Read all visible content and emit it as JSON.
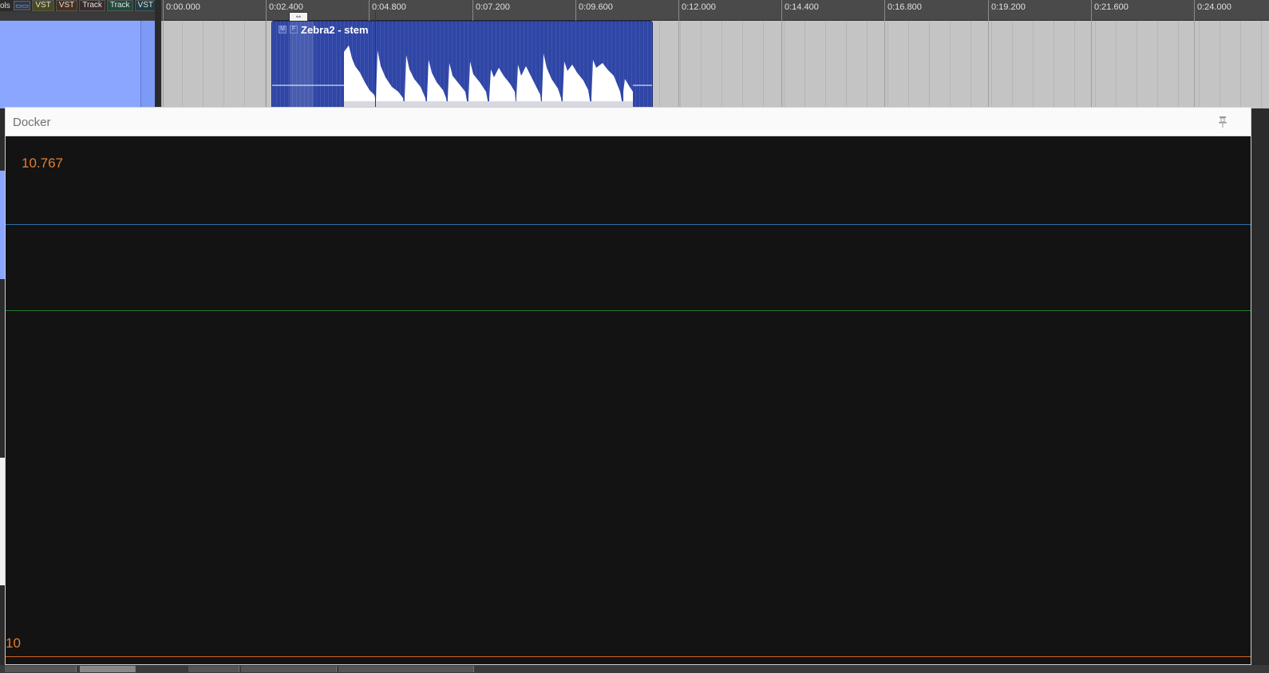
{
  "toolbar": {
    "cut_label": "ols",
    "buttons": [
      "VST",
      "VST",
      "Track",
      "Track",
      "VST"
    ]
  },
  "ruler": {
    "labels": [
      "0:00.000",
      "0:02.400",
      "0:04.800",
      "0:07.200",
      "0:09.600",
      "0:12.000",
      "0:14.400",
      "0:16.800",
      "0:19.200",
      "0:21.600",
      "0:24.000"
    ]
  },
  "media_item": {
    "title": "Zebra2 - stem",
    "color": "#2f46a6"
  },
  "docker": {
    "title": "Docker",
    "value": "10.767",
    "min_value": "10",
    "value_color": "#e87d2c"
  },
  "colors": {
    "track_panel": "#8aa6ff",
    "arrange_bg": "#c4c4c4",
    "line_blue": "#2b6fa8",
    "line_green": "#247a2c",
    "line_orange": "#c9631f"
  },
  "icons": {
    "pin": "pin-icon",
    "resize_cursor": "horizontal-resize-cursor-icon"
  }
}
